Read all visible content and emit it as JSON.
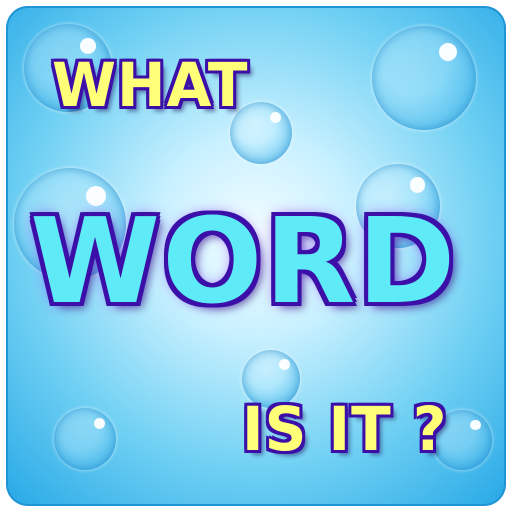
{
  "app_icon": {
    "title_top": "WHAT",
    "title_main": "WORD",
    "title_bottom": "IS IT ?"
  },
  "colors": {
    "background": "#6fd0f3",
    "main_text": "#5eeaf6",
    "secondary_text": "#ffff78",
    "outline": "#3b0fa8"
  }
}
